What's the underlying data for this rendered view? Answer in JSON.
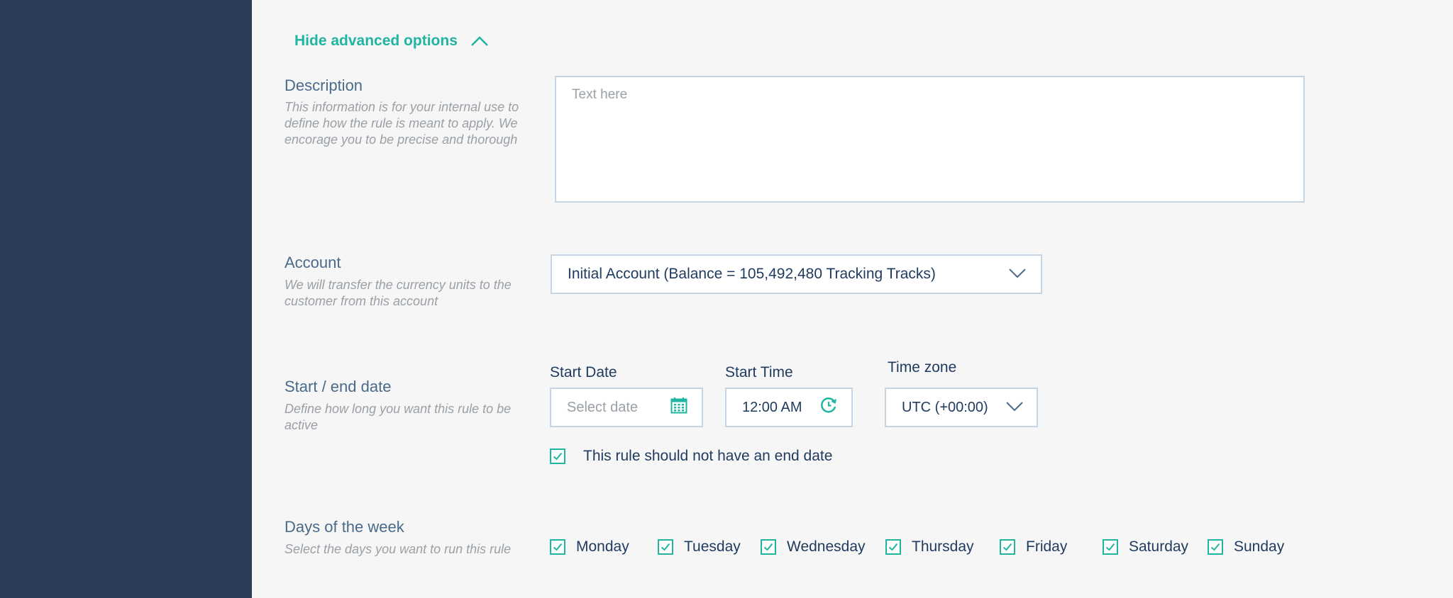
{
  "advanced": {
    "toggle_label": "Hide advanced options"
  },
  "description": {
    "title": "Description",
    "help": "This information is for your internal use to define how the rule is meant to apply. We encorage you to be precise and thorough",
    "placeholder": "Text here",
    "value": ""
  },
  "account": {
    "title": "Account",
    "help": "We will transfer the currency units to the customer from this account",
    "selected": "Initial Account (Balance = 105,492,480 Tracking Tracks)"
  },
  "dates": {
    "title": "Start / end date",
    "help": "Define how long you want this rule to be active",
    "start_date_label": "Start Date",
    "start_date_placeholder": "Select date",
    "start_time_label": "Start Time",
    "start_time_value": "12:00 AM",
    "timezone_label": "Time zone",
    "timezone_value": "UTC (+00:00)",
    "no_end_label": "This rule should not have an end date",
    "no_end_checked": true
  },
  "days": {
    "title": "Days of the week",
    "help": "Select the days you want to run this rule",
    "items": [
      {
        "label": "Monday",
        "checked": true
      },
      {
        "label": "Tuesday",
        "checked": true
      },
      {
        "label": "Wednesday",
        "checked": true
      },
      {
        "label": "Thursday",
        "checked": true
      },
      {
        "label": "Friday",
        "checked": true
      },
      {
        "label": "Saturday",
        "checked": true
      },
      {
        "label": "Sunday",
        "checked": true
      }
    ]
  },
  "colors": {
    "accent": "#1fb5a0",
    "sidebar": "#2c3e57",
    "text_dark": "#1e3a5f"
  }
}
